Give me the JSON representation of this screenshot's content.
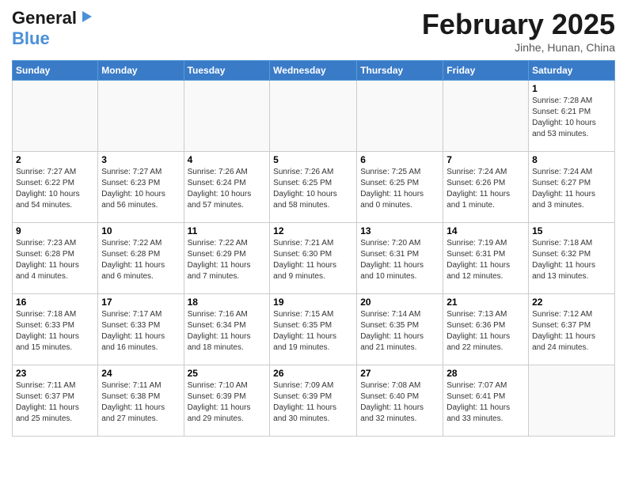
{
  "header": {
    "logo_line1": "General",
    "logo_line2": "Blue",
    "month_title": "February 2025",
    "location": "Jinhe, Hunan, China"
  },
  "weekdays": [
    "Sunday",
    "Monday",
    "Tuesday",
    "Wednesday",
    "Thursday",
    "Friday",
    "Saturday"
  ],
  "days": [
    {
      "num": "",
      "info": ""
    },
    {
      "num": "",
      "info": ""
    },
    {
      "num": "",
      "info": ""
    },
    {
      "num": "",
      "info": ""
    },
    {
      "num": "",
      "info": ""
    },
    {
      "num": "",
      "info": ""
    },
    {
      "num": "1",
      "info": "Sunrise: 7:28 AM\nSunset: 6:21 PM\nDaylight: 10 hours\nand 53 minutes."
    },
    {
      "num": "2",
      "info": "Sunrise: 7:27 AM\nSunset: 6:22 PM\nDaylight: 10 hours\nand 54 minutes."
    },
    {
      "num": "3",
      "info": "Sunrise: 7:27 AM\nSunset: 6:23 PM\nDaylight: 10 hours\nand 56 minutes."
    },
    {
      "num": "4",
      "info": "Sunrise: 7:26 AM\nSunset: 6:24 PM\nDaylight: 10 hours\nand 57 minutes."
    },
    {
      "num": "5",
      "info": "Sunrise: 7:26 AM\nSunset: 6:25 PM\nDaylight: 10 hours\nand 58 minutes."
    },
    {
      "num": "6",
      "info": "Sunrise: 7:25 AM\nSunset: 6:25 PM\nDaylight: 11 hours\nand 0 minutes."
    },
    {
      "num": "7",
      "info": "Sunrise: 7:24 AM\nSunset: 6:26 PM\nDaylight: 11 hours\nand 1 minute."
    },
    {
      "num": "8",
      "info": "Sunrise: 7:24 AM\nSunset: 6:27 PM\nDaylight: 11 hours\nand 3 minutes."
    },
    {
      "num": "9",
      "info": "Sunrise: 7:23 AM\nSunset: 6:28 PM\nDaylight: 11 hours\nand 4 minutes."
    },
    {
      "num": "10",
      "info": "Sunrise: 7:22 AM\nSunset: 6:28 PM\nDaylight: 11 hours\nand 6 minutes."
    },
    {
      "num": "11",
      "info": "Sunrise: 7:22 AM\nSunset: 6:29 PM\nDaylight: 11 hours\nand 7 minutes."
    },
    {
      "num": "12",
      "info": "Sunrise: 7:21 AM\nSunset: 6:30 PM\nDaylight: 11 hours\nand 9 minutes."
    },
    {
      "num": "13",
      "info": "Sunrise: 7:20 AM\nSunset: 6:31 PM\nDaylight: 11 hours\nand 10 minutes."
    },
    {
      "num": "14",
      "info": "Sunrise: 7:19 AM\nSunset: 6:31 PM\nDaylight: 11 hours\nand 12 minutes."
    },
    {
      "num": "15",
      "info": "Sunrise: 7:18 AM\nSunset: 6:32 PM\nDaylight: 11 hours\nand 13 minutes."
    },
    {
      "num": "16",
      "info": "Sunrise: 7:18 AM\nSunset: 6:33 PM\nDaylight: 11 hours\nand 15 minutes."
    },
    {
      "num": "17",
      "info": "Sunrise: 7:17 AM\nSunset: 6:33 PM\nDaylight: 11 hours\nand 16 minutes."
    },
    {
      "num": "18",
      "info": "Sunrise: 7:16 AM\nSunset: 6:34 PM\nDaylight: 11 hours\nand 18 minutes."
    },
    {
      "num": "19",
      "info": "Sunrise: 7:15 AM\nSunset: 6:35 PM\nDaylight: 11 hours\nand 19 minutes."
    },
    {
      "num": "20",
      "info": "Sunrise: 7:14 AM\nSunset: 6:35 PM\nDaylight: 11 hours\nand 21 minutes."
    },
    {
      "num": "21",
      "info": "Sunrise: 7:13 AM\nSunset: 6:36 PM\nDaylight: 11 hours\nand 22 minutes."
    },
    {
      "num": "22",
      "info": "Sunrise: 7:12 AM\nSunset: 6:37 PM\nDaylight: 11 hours\nand 24 minutes."
    },
    {
      "num": "23",
      "info": "Sunrise: 7:11 AM\nSunset: 6:37 PM\nDaylight: 11 hours\nand 25 minutes."
    },
    {
      "num": "24",
      "info": "Sunrise: 7:11 AM\nSunset: 6:38 PM\nDaylight: 11 hours\nand 27 minutes."
    },
    {
      "num": "25",
      "info": "Sunrise: 7:10 AM\nSunset: 6:39 PM\nDaylight: 11 hours\nand 29 minutes."
    },
    {
      "num": "26",
      "info": "Sunrise: 7:09 AM\nSunset: 6:39 PM\nDaylight: 11 hours\nand 30 minutes."
    },
    {
      "num": "27",
      "info": "Sunrise: 7:08 AM\nSunset: 6:40 PM\nDaylight: 11 hours\nand 32 minutes."
    },
    {
      "num": "28",
      "info": "Sunrise: 7:07 AM\nSunset: 6:41 PM\nDaylight: 11 hours\nand 33 minutes."
    },
    {
      "num": "",
      "info": ""
    },
    {
      "num": "",
      "info": ""
    },
    {
      "num": "",
      "info": ""
    },
    {
      "num": "",
      "info": ""
    },
    {
      "num": "",
      "info": ""
    },
    {
      "num": "",
      "info": ""
    }
  ]
}
